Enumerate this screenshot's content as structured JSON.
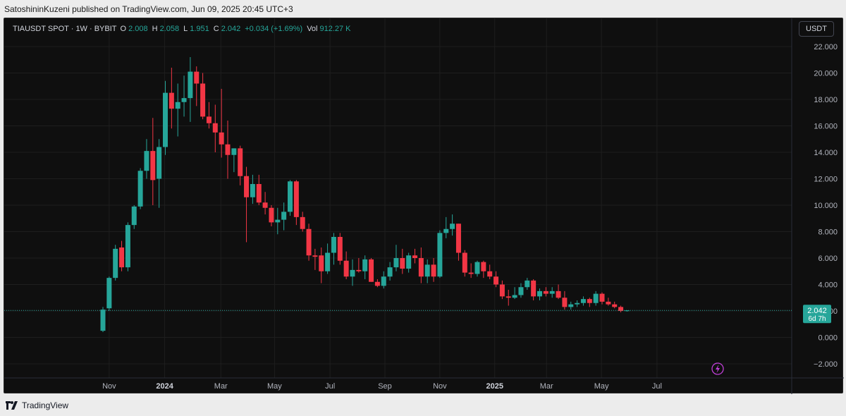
{
  "publish_line": "SatoshininKuzeni published on TradingView.com, Jun 09, 2025 20:45 UTC+3",
  "legend": {
    "symbol": "TIAUSDT SPOT · 1W · BYBIT",
    "o_label": "O",
    "o_value": "2.008",
    "h_label": "H",
    "h_value": "2.058",
    "l_label": "L",
    "l_value": "1.951",
    "c_label": "C",
    "c_value": "2.042",
    "change": "+0.034 (+1.69%)",
    "vol_label": "Vol",
    "vol_value": "912.27 K"
  },
  "currency_button": "USDT",
  "price_label": {
    "price": "2.042",
    "countdown": "6d 7h"
  },
  "footer_brand": "TradingView",
  "colors": {
    "up": "#26a69a",
    "down": "#f23645",
    "background": "#0f0f0f",
    "grid": "#1e1e1e"
  },
  "chart_data": {
    "type": "candlestick",
    "symbol": "TIAUSDT",
    "timeframe": "1W",
    "ylim": [
      -2.0,
      22.0
    ],
    "yticks": [
      -2,
      0,
      2,
      4,
      6,
      8,
      10,
      12,
      14,
      16,
      18,
      20,
      22
    ],
    "ytick_labels": [
      "−2.000",
      "0.000",
      "2.000",
      "4.000",
      "6.000",
      "8.000",
      "10.000",
      "12.000",
      "14.000",
      "16.000",
      "18.000",
      "20.000",
      "22.000"
    ],
    "xticks": [
      {
        "label": "Nov",
        "index": 1,
        "bold": false
      },
      {
        "label": "2024",
        "index": 9.9,
        "bold": true
      },
      {
        "label": "Mar",
        "index": 18.9,
        "bold": false
      },
      {
        "label": "May",
        "index": 27.5,
        "bold": false
      },
      {
        "label": "Jul",
        "index": 36.4,
        "bold": false
      },
      {
        "label": "Sep",
        "index": 45.2,
        "bold": false
      },
      {
        "label": "Nov",
        "index": 54.0,
        "bold": false
      },
      {
        "label": "2025",
        "index": 62.8,
        "bold": true
      },
      {
        "label": "Mar",
        "index": 71.1,
        "bold": false
      },
      {
        "label": "May",
        "index": 79.9,
        "bold": false
      },
      {
        "label": "Jul",
        "index": 88.8,
        "bold": false
      }
    ],
    "last_price": 2.042,
    "candles": [
      {
        "o": 0.5,
        "h": 2.3,
        "l": 0.4,
        "c": 2.1
      },
      {
        "o": 2.2,
        "h": 4.6,
        "l": 2.0,
        "c": 4.5
      },
      {
        "o": 4.5,
        "h": 7.0,
        "l": 4.3,
        "c": 6.7
      },
      {
        "o": 6.8,
        "h": 7.3,
        "l": 5.0,
        "c": 5.3
      },
      {
        "o": 5.3,
        "h": 8.7,
        "l": 5.0,
        "c": 8.5
      },
      {
        "o": 8.5,
        "h": 10.0,
        "l": 8.2,
        "c": 9.9
      },
      {
        "o": 9.9,
        "h": 12.8,
        "l": 9.7,
        "c": 12.6
      },
      {
        "o": 12.6,
        "h": 15.0,
        "l": 12.0,
        "c": 14.1
      },
      {
        "o": 14.1,
        "h": 16.6,
        "l": 10.0,
        "c": 11.9
      },
      {
        "o": 12.0,
        "h": 15.0,
        "l": 9.8,
        "c": 14.4
      },
      {
        "o": 14.4,
        "h": 19.4,
        "l": 13.8,
        "c": 18.5
      },
      {
        "o": 18.5,
        "h": 20.4,
        "l": 15.8,
        "c": 17.3
      },
      {
        "o": 17.3,
        "h": 19.2,
        "l": 15.2,
        "c": 17.8
      },
      {
        "o": 17.8,
        "h": 19.8,
        "l": 16.7,
        "c": 18.1
      },
      {
        "o": 18.1,
        "h": 21.2,
        "l": 16.3,
        "c": 20.1
      },
      {
        "o": 20.1,
        "h": 20.5,
        "l": 17.5,
        "c": 19.2
      },
      {
        "o": 19.2,
        "h": 20.0,
        "l": 16.5,
        "c": 16.7
      },
      {
        "o": 16.7,
        "h": 17.8,
        "l": 15.8,
        "c": 16.2
      },
      {
        "o": 16.2,
        "h": 17.6,
        "l": 14.0,
        "c": 15.5
      },
      {
        "o": 15.5,
        "h": 18.8,
        "l": 13.6,
        "c": 14.6
      },
      {
        "o": 14.6,
        "h": 16.4,
        "l": 12.0,
        "c": 13.8
      },
      {
        "o": 13.8,
        "h": 14.3,
        "l": 12.5,
        "c": 14.3
      },
      {
        "o": 14.3,
        "h": 14.5,
        "l": 11.5,
        "c": 12.2
      },
      {
        "o": 12.2,
        "h": 12.9,
        "l": 7.2,
        "c": 10.6
      },
      {
        "o": 10.6,
        "h": 12.3,
        "l": 10.1,
        "c": 11.6
      },
      {
        "o": 11.6,
        "h": 12.3,
        "l": 10.0,
        "c": 10.2
      },
      {
        "o": 10.2,
        "h": 11.0,
        "l": 9.3,
        "c": 9.8
      },
      {
        "o": 9.8,
        "h": 10.0,
        "l": 8.4,
        "c": 8.7
      },
      {
        "o": 8.7,
        "h": 9.8,
        "l": 7.8,
        "c": 8.9
      },
      {
        "o": 8.9,
        "h": 10.2,
        "l": 8.1,
        "c": 9.5
      },
      {
        "o": 9.5,
        "h": 11.9,
        "l": 9.2,
        "c": 11.8
      },
      {
        "o": 11.8,
        "h": 11.9,
        "l": 8.5,
        "c": 9.1
      },
      {
        "o": 9.1,
        "h": 9.5,
        "l": 8.0,
        "c": 8.2
      },
      {
        "o": 8.2,
        "h": 8.6,
        "l": 5.8,
        "c": 6.2
      },
      {
        "o": 6.2,
        "h": 6.7,
        "l": 5.1,
        "c": 6.1
      },
      {
        "o": 6.2,
        "h": 6.8,
        "l": 4.1,
        "c": 5.0
      },
      {
        "o": 5.0,
        "h": 7.1,
        "l": 4.8,
        "c": 6.4
      },
      {
        "o": 6.4,
        "h": 7.9,
        "l": 5.5,
        "c": 7.6
      },
      {
        "o": 7.6,
        "h": 7.9,
        "l": 5.5,
        "c": 5.8
      },
      {
        "o": 5.8,
        "h": 6.5,
        "l": 4.4,
        "c": 4.6
      },
      {
        "o": 4.6,
        "h": 5.9,
        "l": 3.9,
        "c": 5.1
      },
      {
        "o": 5.1,
        "h": 6.0,
        "l": 4.9,
        "c": 5.0
      },
      {
        "o": 5.0,
        "h": 6.2,
        "l": 4.4,
        "c": 5.9
      },
      {
        "o": 5.9,
        "h": 6.0,
        "l": 4.2,
        "c": 4.2
      },
      {
        "o": 4.2,
        "h": 4.4,
        "l": 3.8,
        "c": 3.9
      },
      {
        "o": 3.9,
        "h": 5.0,
        "l": 3.7,
        "c": 4.6
      },
      {
        "o": 4.6,
        "h": 5.7,
        "l": 4.3,
        "c": 5.3
      },
      {
        "o": 5.3,
        "h": 7.0,
        "l": 5.0,
        "c": 6.0
      },
      {
        "o": 6.0,
        "h": 6.7,
        "l": 4.8,
        "c": 5.2
      },
      {
        "o": 5.2,
        "h": 6.4,
        "l": 4.9,
        "c": 6.2
      },
      {
        "o": 6.2,
        "h": 6.7,
        "l": 5.6,
        "c": 6.0
      },
      {
        "o": 6.0,
        "h": 6.8,
        "l": 4.1,
        "c": 4.6
      },
      {
        "o": 4.6,
        "h": 5.9,
        "l": 4.1,
        "c": 5.5
      },
      {
        "o": 5.5,
        "h": 6.0,
        "l": 4.2,
        "c": 4.6
      },
      {
        "o": 4.6,
        "h": 8.1,
        "l": 4.5,
        "c": 7.9
      },
      {
        "o": 7.9,
        "h": 9.1,
        "l": 7.5,
        "c": 8.2
      },
      {
        "o": 8.2,
        "h": 9.3,
        "l": 7.7,
        "c": 8.6
      },
      {
        "o": 8.6,
        "h": 8.6,
        "l": 5.8,
        "c": 6.4
      },
      {
        "o": 6.4,
        "h": 6.6,
        "l": 4.6,
        "c": 4.9
      },
      {
        "o": 4.9,
        "h": 5.6,
        "l": 4.5,
        "c": 4.8
      },
      {
        "o": 4.8,
        "h": 5.8,
        "l": 4.6,
        "c": 5.7
      },
      {
        "o": 5.7,
        "h": 5.8,
        "l": 4.5,
        "c": 5.0
      },
      {
        "o": 5.0,
        "h": 5.5,
        "l": 4.4,
        "c": 4.6
      },
      {
        "o": 4.6,
        "h": 5.0,
        "l": 3.8,
        "c": 4.0
      },
      {
        "o": 4.0,
        "h": 4.3,
        "l": 2.9,
        "c": 3.1
      },
      {
        "o": 3.1,
        "h": 3.6,
        "l": 2.4,
        "c": 3.0
      },
      {
        "o": 3.0,
        "h": 3.8,
        "l": 2.9,
        "c": 3.2
      },
      {
        "o": 3.2,
        "h": 4.1,
        "l": 3.0,
        "c": 3.8
      },
      {
        "o": 3.8,
        "h": 4.5,
        "l": 3.6,
        "c": 4.3
      },
      {
        "o": 4.3,
        "h": 4.4,
        "l": 2.8,
        "c": 3.1
      },
      {
        "o": 3.1,
        "h": 3.7,
        "l": 2.8,
        "c": 3.5
      },
      {
        "o": 3.5,
        "h": 3.8,
        "l": 3.1,
        "c": 3.3
      },
      {
        "o": 3.3,
        "h": 3.8,
        "l": 3.0,
        "c": 3.5
      },
      {
        "o": 3.5,
        "h": 4.0,
        "l": 2.9,
        "c": 3.0
      },
      {
        "o": 3.0,
        "h": 3.5,
        "l": 2.1,
        "c": 2.3
      },
      {
        "o": 2.3,
        "h": 2.7,
        "l": 2.1,
        "c": 2.5
      },
      {
        "o": 2.5,
        "h": 2.8,
        "l": 2.3,
        "c": 2.6
      },
      {
        "o": 2.6,
        "h": 3.1,
        "l": 2.4,
        "c": 2.9
      },
      {
        "o": 2.9,
        "h": 3.0,
        "l": 2.3,
        "c": 2.6
      },
      {
        "o": 2.6,
        "h": 3.5,
        "l": 2.4,
        "c": 3.3
      },
      {
        "o": 3.3,
        "h": 3.4,
        "l": 2.5,
        "c": 2.7
      },
      {
        "o": 2.7,
        "h": 3.0,
        "l": 2.4,
        "c": 2.5
      },
      {
        "o": 2.5,
        "h": 2.7,
        "l": 2.2,
        "c": 2.3
      },
      {
        "o": 2.3,
        "h": 2.4,
        "l": 1.9,
        "c": 2.0
      },
      {
        "o": 2.008,
        "h": 2.058,
        "l": 1.951,
        "c": 2.042
      }
    ]
  }
}
